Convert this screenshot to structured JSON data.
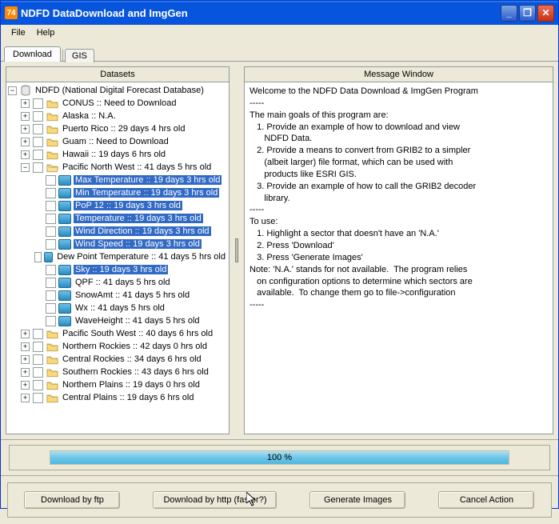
{
  "title": "NDFD DataDownload and ImgGen",
  "menus": {
    "file": "File",
    "help": "Help"
  },
  "tabs": {
    "download": "Download",
    "gis": "GIS"
  },
  "panels": {
    "left_header": "Datasets",
    "right_header": "Message Window"
  },
  "tree": {
    "root": {
      "label": "NDFD (National Digital Forecast Database)"
    },
    "folders": [
      {
        "label": "CONUS :: Need to Download"
      },
      {
        "label": "Alaska :: N.A."
      },
      {
        "label": "Puerto Rico :: 29 days 4 hrs old"
      },
      {
        "label": "Guam :: Need to Download"
      },
      {
        "label": "Hawaii :: 19 days 6 hrs old"
      },
      {
        "label": "Pacific North West :: 41 days 5 hrs old",
        "expanded": true
      }
    ],
    "pnw_items": [
      {
        "label": "Max Temperature :: 19 days 3 hrs old",
        "sel": true
      },
      {
        "label": "Min Temperature :: 19 days 3 hrs old",
        "sel": true
      },
      {
        "label": "PoP 12 :: 19 days 3 hrs old",
        "sel": true
      },
      {
        "label": "Temperature :: 19 days 3 hrs old",
        "sel": true
      },
      {
        "label": "Wind Direction :: 19 days 3 hrs old",
        "sel": true
      },
      {
        "label": "Wind Speed :: 19 days 3 hrs old",
        "sel": true
      },
      {
        "label": "Dew Point Temperature :: 41 days 5 hrs old",
        "sel": false
      },
      {
        "label": "Sky :: 19 days 3 hrs old",
        "sel": true
      },
      {
        "label": "QPF :: 41 days 5 hrs old",
        "sel": false
      },
      {
        "label": "SnowAmt :: 41 days 5 hrs old",
        "sel": false
      },
      {
        "label": "Wx :: 41 days 5 hrs old",
        "sel": false
      },
      {
        "label": "WaveHeight :: 41 days 5 hrs old",
        "sel": false
      }
    ],
    "more_folders": [
      {
        "label": "Pacific South West :: 40 days 6 hrs old"
      },
      {
        "label": "Northern Rockies :: 42 days 0 hrs old"
      },
      {
        "label": "Central Rockies :: 34 days 6 hrs old"
      },
      {
        "label": "Southern Rockies :: 43 days 6 hrs old"
      },
      {
        "label": "Northern Plains :: 19 days 0 hrs old"
      },
      {
        "label": "Central Plains :: 19 days 6 hrs old"
      }
    ]
  },
  "message": "Welcome to the NDFD Data Download & ImgGen Program\n-----\nThe main goals of this program are:\n   1. Provide an example of how to download and view\n      NDFD Data.\n   2. Provide a means to convert from GRIB2 to a simpler\n      (albeit larger) file format, which can be used with\n      products like ESRI GIS.\n   3. Provide an example of how to call the GRIB2 decoder\n      library.\n-----\nTo use:\n   1. Highlight a sector that doesn't have an 'N.A.'\n   2. Press 'Download'\n   3. Press 'Generate Images'\nNote: 'N.A.' stands for not available.  The program relies\n   on configuration options to determine which sectors are\n   available.  To change them go to file->configuration\n-----",
  "progress": {
    "text": "100 %",
    "percent": 100
  },
  "buttons": {
    "ftp": "Download by ftp",
    "http": "Download by http (faster?)",
    "gen": "Generate Images",
    "cancel": "Cancel Action"
  }
}
